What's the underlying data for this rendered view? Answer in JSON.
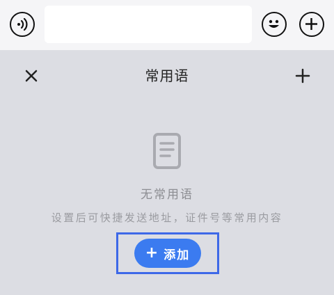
{
  "input_bar": {
    "voice_icon": "voice-icon",
    "text_value": "",
    "emoji_icon": "emoji-icon",
    "more_icon": "plus-circle-icon"
  },
  "panel": {
    "title": "常用语",
    "close_icon": "close-icon",
    "add_icon": "plus-icon",
    "empty_state": {
      "icon": "document-icon",
      "title": "无常用语",
      "description": "设置后可快捷发送地址，证件号等常用内容",
      "add_button_label": "添加"
    }
  },
  "colors": {
    "accent": "#3b7bf0",
    "highlight": "#3d68e8",
    "panel_bg": "#dcdde3"
  }
}
